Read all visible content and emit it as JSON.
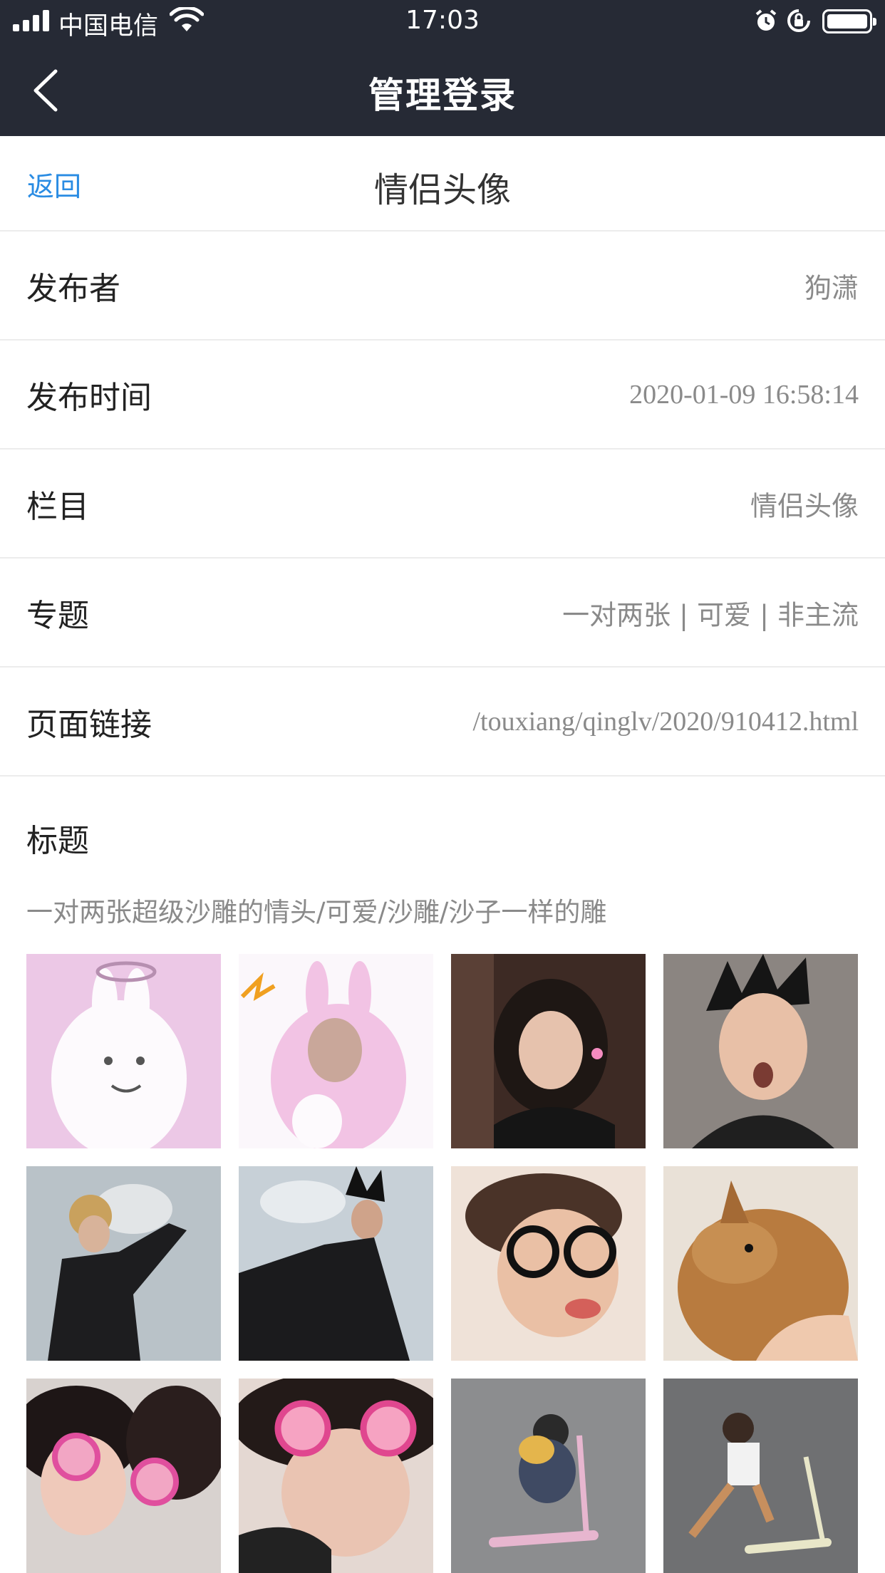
{
  "status": {
    "carrier": "中国电信",
    "time": "17:03"
  },
  "nav": {
    "title": "管理登录"
  },
  "header": {
    "back_label": "返回",
    "title": "情侣头像"
  },
  "details": [
    {
      "label": "发布者",
      "value": "狗潇"
    },
    {
      "label": "发布时间",
      "value": "2020-01-09 16:58:14"
    },
    {
      "label": "栏目",
      "value": "情侣头像"
    },
    {
      "label": "专题",
      "value": "一对两张 | 可爱 | 非主流"
    },
    {
      "label": "页面链接",
      "value": "/touxiang/qinglv/2020/910412.html"
    }
  ],
  "title_section": {
    "label": "标题",
    "text": "一对两张超级沙雕的情头/可爱/沙雕/沙子一样的雕"
  },
  "colors": {
    "topbar": "#262a35",
    "link": "#2a8ce3",
    "muted": "#8a8a8a"
  }
}
